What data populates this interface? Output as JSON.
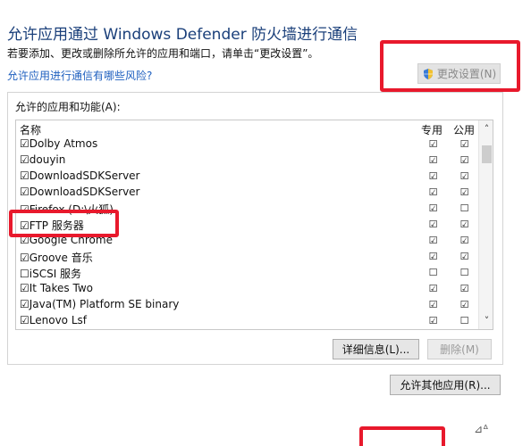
{
  "header": {
    "title": "允许应用通过 Windows Defender 防火墙进行通信",
    "subtitle": "若要添加、更改或删除所允许的应用和端口，请单击“更改设置”。",
    "risk_link": "允许应用进行通信有哪些风险?",
    "change_settings_label": "更改设置(N)"
  },
  "panel": {
    "label": "允许的应用和功能(A):",
    "columns": {
      "name": "名称",
      "private": "专用",
      "public": "公用"
    },
    "rows": [
      {
        "name": "☑Dolby Atmos",
        "private": "☑",
        "public": "☑"
      },
      {
        "name": "☑douyin",
        "private": "☑",
        "public": "☑"
      },
      {
        "name": "☑DownloadSDKServer",
        "private": "☑",
        "public": "☑"
      },
      {
        "name": "☑DownloadSDKServer",
        "private": "☑",
        "public": "☑"
      },
      {
        "name": "☑Firefox (D:\\火狐)",
        "private": "☑",
        "public": "☐"
      },
      {
        "name": "☑FTP 服务器",
        "private": "☑",
        "public": "☑"
      },
      {
        "name": "☑Google Chrome",
        "private": "☑",
        "public": "☑"
      },
      {
        "name": "☑Groove 音乐",
        "private": "☑",
        "public": "☑"
      },
      {
        "name": "☐iSCSI 服务",
        "private": "☐",
        "public": "☐"
      },
      {
        "name": "☑It Takes Two",
        "private": "☑",
        "public": "☑"
      },
      {
        "name": "☑Java(TM) Platform SE binary",
        "private": "☑",
        "public": "☑"
      },
      {
        "name": "☑Lenovo Lsf",
        "private": "☑",
        "public": "☐"
      }
    ],
    "details_label": "详细信息(L)...",
    "remove_label": "删除(M)"
  },
  "allow_other_label": "允许其他应用(R)...",
  "colors": {
    "highlight": "#e8192c",
    "title": "#1a3f7a",
    "link": "#1e5fbf"
  }
}
